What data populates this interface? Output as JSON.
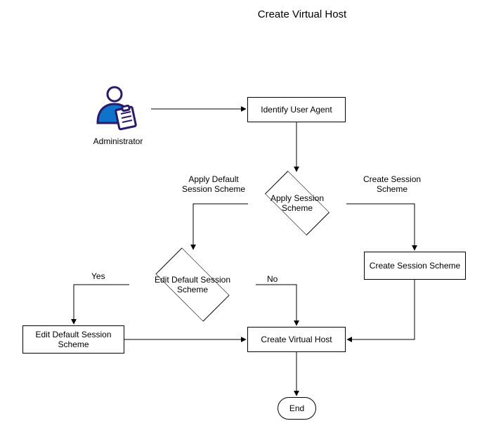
{
  "title": "Create Virtual Host",
  "actor": {
    "label": "Administrator",
    "icon": "administrator-icon"
  },
  "nodes": {
    "identify_user_agent": "Identify User Agent",
    "apply_session_scheme": "Apply Session Scheme",
    "create_session_scheme": "Create Session Scheme",
    "edit_default_session_scheme_decision": "Edit Default Session Scheme",
    "edit_default_session_scheme_action": "Edit Default Session Scheme",
    "create_virtual_host": "Create Virtual Host",
    "end": "End"
  },
  "edge_labels": {
    "apply_default_session_scheme": "Apply Default\nSession Scheme",
    "create_session_scheme": "Create Session\nScheme",
    "yes": "Yes",
    "no": "No"
  }
}
